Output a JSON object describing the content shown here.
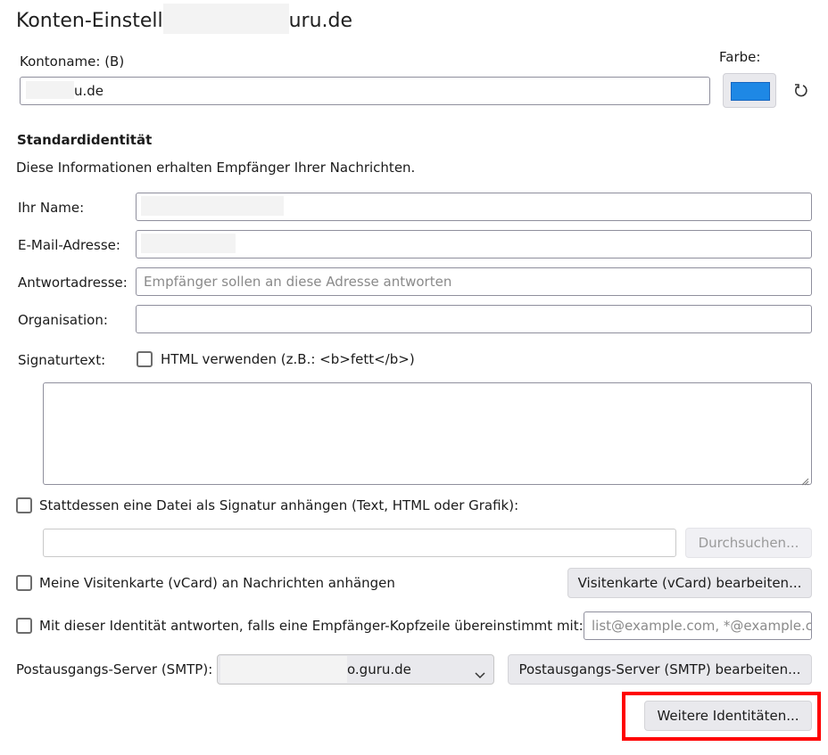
{
  "header": {
    "title_prefix": "Konten-Einstell",
    "title_suffix": "uru.de"
  },
  "account": {
    "name_label": "Kontoname: (B)",
    "name_value_suffix": "u.de",
    "color_label": "Farbe:",
    "color_value": "#1e88e5",
    "reset_icon": "reset-icon"
  },
  "identity": {
    "heading": "Standardidentität",
    "description": "Diese Informationen erhalten Empfänger Ihrer Nachrichten.",
    "name_label": "Ihr Name:",
    "email_label": "E-Mail-Adresse:",
    "reply_label": "Antwortadresse:",
    "reply_placeholder": "Empfänger sollen an diese Adresse antworten",
    "org_label": "Organisation:",
    "signature_label": "Signaturtext:",
    "html_checkbox_label": "HTML verwenden (z.B.: <b>fett</b>)"
  },
  "attach_signature": {
    "label": "Stattdessen eine Datei als Signatur anhängen (Text, HTML oder Grafik):",
    "browse_label": "Durchsuchen..."
  },
  "vcard": {
    "label": "Meine Visitenkarte (vCard) an Nachrichten anhängen",
    "edit_label": "Visitenkarte (vCard) bearbeiten..."
  },
  "reply_match": {
    "label": "Mit dieser Identität antworten, falls eine Empfänger-Kopfzeile übereinstimmt mit:",
    "placeholder": "list@example.com, *@example.com"
  },
  "smtp": {
    "label": "Postausgangs-Server (SMTP):",
    "selected_suffix": "o.guru.de",
    "edit_label": "Postausgangs-Server (SMTP) bearbeiten..."
  },
  "more_identities_label": "Weitere Identitäten..."
}
